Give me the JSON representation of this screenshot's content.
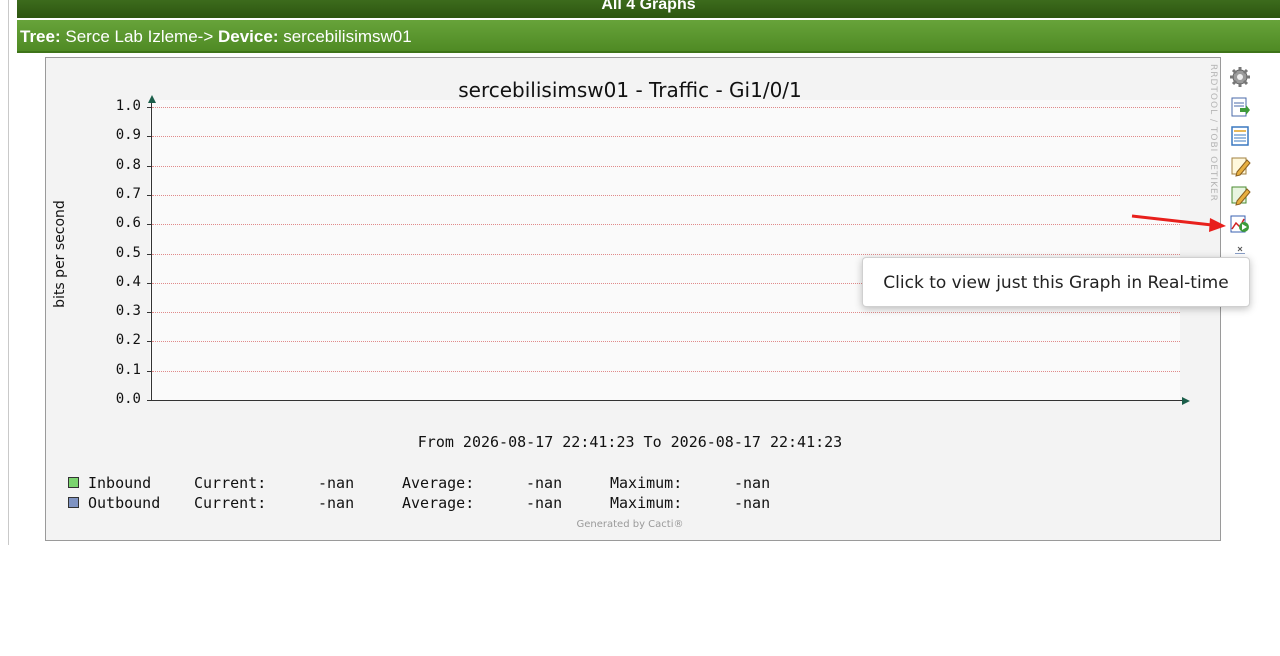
{
  "header": {
    "title": "All 4 Graphs"
  },
  "breadcrumb": {
    "tree_label": "Tree:",
    "tree_value": "Serce Lab Izleme->",
    "device_label": "Device:",
    "device_value": "sercebilisimsw01"
  },
  "graph": {
    "title": "sercebilisimsw01 - Traffic - Gi1/0/1",
    "ylabel": "bits per second",
    "yticks": [
      "1.0",
      "0.9",
      "0.8",
      "0.7",
      "0.6",
      "0.5",
      "0.4",
      "0.3",
      "0.2",
      "0.1",
      "0.0"
    ],
    "range_text": "From 2026-08-17 22:41:23 To 2026-08-17 22:41:23",
    "watermark": "RRDTOOL / TOBI OETIKER",
    "generated_by": "Generated by Cacti®",
    "legend": [
      {
        "name": "Inbound",
        "color": "#7bd46f",
        "current_label": "Current:",
        "current": "-nan",
        "average_label": "Average:",
        "average": "-nan",
        "maximum_label": "Maximum:",
        "maximum": "-nan"
      },
      {
        "name": "Outbound",
        "color": "#7f93c2",
        "current_label": "Current:",
        "current": "-nan",
        "average_label": "Average:",
        "average": "-nan",
        "maximum_label": "Maximum:",
        "maximum": "-nan"
      }
    ]
  },
  "chart_data": {
    "type": "line",
    "title": "sercebilisimsw01 - Traffic - Gi1/0/1",
    "ylabel": "bits per second",
    "ylim": [
      0,
      1.0
    ],
    "grid": true,
    "series": [
      {
        "name": "Inbound",
        "values": []
      },
      {
        "name": "Outbound",
        "values": []
      }
    ]
  },
  "side_actions": [
    {
      "icon": "gear-icon"
    },
    {
      "icon": "export-csv-icon"
    },
    {
      "icon": "list-icon"
    },
    {
      "icon": "edit-graph-icon"
    },
    {
      "icon": "edit-template-icon"
    },
    {
      "icon": "realtime-graph-icon"
    },
    {
      "icon": "zoom-icon"
    }
  ],
  "tooltip": {
    "text": "Click to view just this Graph in Real-time"
  },
  "colors": {
    "header_green": "#2d5510",
    "tree_green": "#5a9a2e",
    "grid_red": "#e08a8a",
    "annotation_red": "#e8201c"
  }
}
